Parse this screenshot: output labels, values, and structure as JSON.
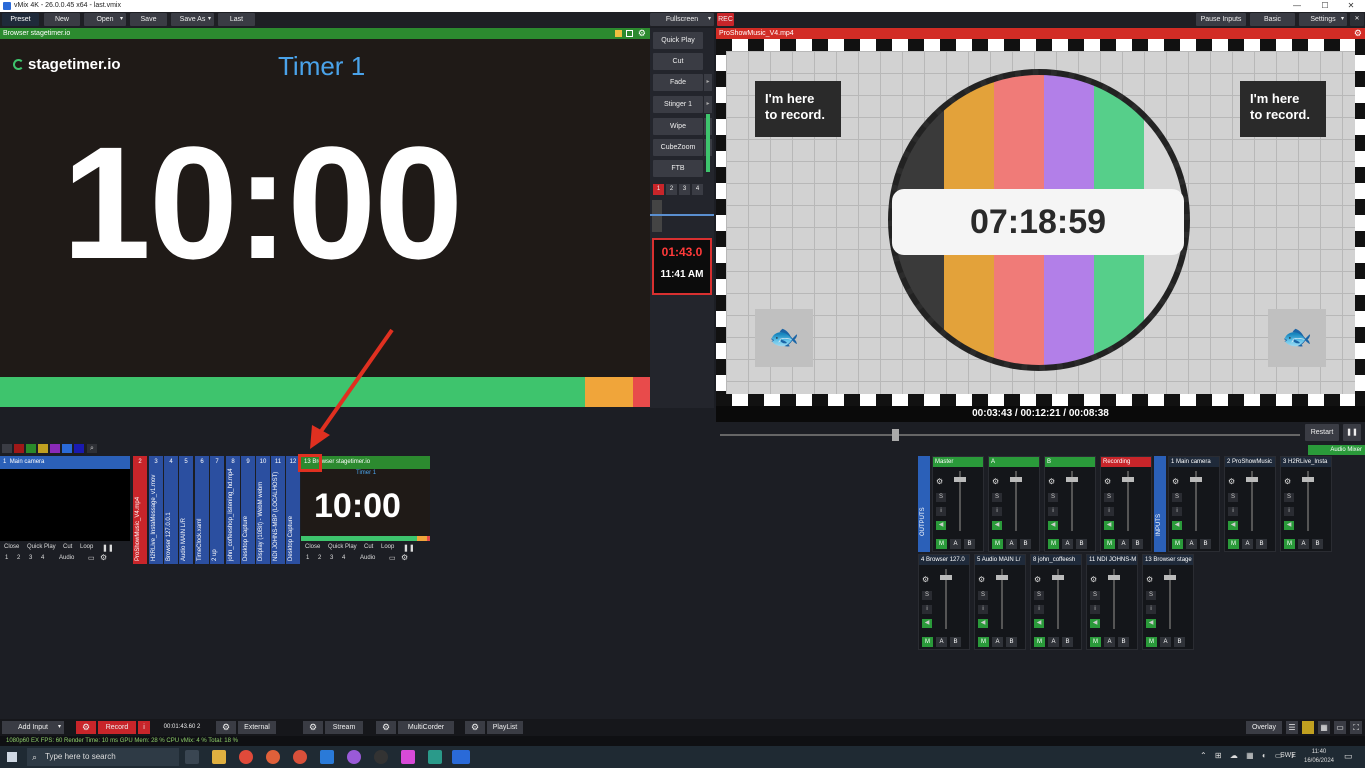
{
  "window": {
    "title": "vMix 4K - 26.0.0.45 x64 - last.vmix",
    "min": "—",
    "max": "☐",
    "close": "✕"
  },
  "toolbar": {
    "preset": "Preset",
    "new": "New",
    "open": "Open",
    "save": "Save",
    "save_as": "Save As",
    "last": "Last",
    "fullscreen": "Fullscreen",
    "rec": "REC",
    "pause_inputs": "Pause Inputs",
    "basic": "Basic",
    "settings": "Settings",
    "min": "—",
    "max": "☐",
    "close": "✕"
  },
  "preview": {
    "header": "Browser stagetimer.io",
    "logo": "stagetimer.io",
    "timer_title": "Timer 1",
    "time": "10:00"
  },
  "transitions": {
    "quick_play": "Quick Play",
    "cut": "Cut",
    "fade": "Fade",
    "stinger": "Stinger 1",
    "wipe": "Wipe",
    "cubezoom": "CubeZoom",
    "ftb": "FTB",
    "numbers": [
      "1",
      "2",
      "3",
      "4"
    ],
    "countdown": "01:43.0",
    "clock": "11:41 AM"
  },
  "output": {
    "header": "ProShowMusic_V4.mp4",
    "card_text": "I'm here\nto record.",
    "card_line1": "I'm here",
    "card_line2": "to record.",
    "fish": "🐟",
    "big_time": "07:18:59",
    "timeline": "00:03:43  /  00:12:21  /  00:08:38",
    "restart": "Restart",
    "pause": "❚❚",
    "audio_mixer": "Audio Mixer"
  },
  "inputs": {
    "card1": {
      "num": "1",
      "label": "Main camera",
      "controls": [
        "Close",
        "Quick Play",
        "Cut",
        "Loop"
      ],
      "nums": [
        "1",
        "2",
        "3",
        "4"
      ],
      "audio": "Audio"
    },
    "vtabs": [
      {
        "num": "2",
        "label": "ProShowMusic_V4.mp4",
        "color": "#c8252a"
      },
      {
        "num": "3",
        "label": "H2RLive_InstaMessage_v1.mov",
        "color": "#2b4fa0"
      },
      {
        "num": "4",
        "label": "Browser 127.0.0.1",
        "color": "#2b4fa0"
      },
      {
        "num": "5",
        "label": "Audio MAIN L/R",
        "color": "#2b4fa0"
      },
      {
        "num": "6",
        "label": "TimeClock.xaml",
        "color": "#2b4fa0"
      },
      {
        "num": "7",
        "label": "2 up",
        "color": "#2b4fa0"
      },
      {
        "num": "8",
        "label": "john_coffeeshop_listening_hd.mp4",
        "color": "#2b4fa0"
      },
      {
        "num": "9",
        "label": "Desktop Capture",
        "color": "#2b4fa0"
      },
      {
        "num": "10",
        "label": "Display (10Bit) - WebM webm",
        "color": "#2b4fa0"
      },
      {
        "num": "11",
        "label": "NDI JOHNS-MBP (LOCALHOST)",
        "color": "#2b4fa0"
      },
      {
        "num": "12",
        "label": "Desktop Capture",
        "color": "#2b4fa0"
      }
    ],
    "card13": {
      "num": "13",
      "label": "Browser stagetimer.io",
      "sub_title": "Timer 1",
      "time": "10:00",
      "controls": [
        "Close",
        "Quick Play",
        "Cut",
        "Loop"
      ],
      "nums": [
        "1",
        "2",
        "3",
        "4"
      ],
      "audio": "Audio"
    }
  },
  "mixer": {
    "outputs_label": "OUTPUTS",
    "inputs_label": "INPUTS",
    "outputs": [
      {
        "name": "Master",
        "color": "#2a9a3a"
      },
      {
        "name": "A",
        "color": "#2a9a3a"
      },
      {
        "name": "B",
        "color": "#2a9a3a"
      },
      {
        "name": "Recording",
        "color": "#c8252a"
      }
    ],
    "inputs_row1": [
      {
        "num": "1",
        "name": "Main camera"
      },
      {
        "num": "2",
        "name": "ProShowMusic"
      },
      {
        "num": "3",
        "name": "H2RLive_Insta"
      }
    ],
    "inputs_row2": [
      {
        "num": "4",
        "name": "Browser 127.0"
      },
      {
        "num": "5",
        "name": "Audio MAIN L/"
      },
      {
        "num": "8",
        "name": "john_coffeesh"
      },
      {
        "num": "11",
        "name": "NDI JOHNS-M"
      },
      {
        "num": "13",
        "name": "Browser stage"
      }
    ],
    "mab": [
      "M",
      "A",
      "B"
    ],
    "s": "S",
    "i": "i",
    "gear": "⚙"
  },
  "bottom": {
    "add_input": "Add Input",
    "record": "Record",
    "rec_time": "00:01:43.60 2",
    "external": "External",
    "stream": "Stream",
    "multicorder": "MultiCorder",
    "playlist": "PlayList",
    "overlay": "Overlay"
  },
  "status": {
    "text": "1080p60    EX  FPS: 60  Render Time: 10 ms  GPU Mem: 28 %  CPU vMix: 4 %  Total: 18 %"
  },
  "taskbar": {
    "search_placeholder": "Type here to search",
    "lang": "SWE",
    "time": "11:40",
    "date": "16/06/2024"
  }
}
